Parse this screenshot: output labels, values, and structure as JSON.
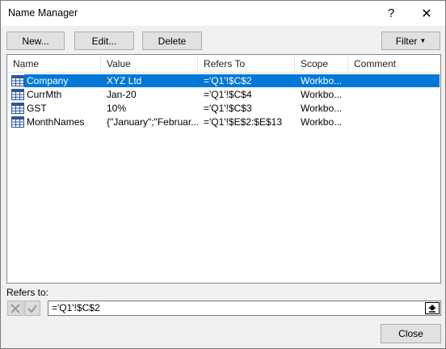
{
  "window": {
    "title": "Name Manager",
    "help_label": "?",
    "close_label": "✕"
  },
  "toolbar": {
    "new_label": "New...",
    "edit_label": "Edit...",
    "delete_label": "Delete",
    "filter_label": "Filter"
  },
  "list": {
    "columns": [
      "Name",
      "Value",
      "Refers To",
      "Scope",
      "Comment"
    ],
    "rows": [
      {
        "name": "Company",
        "value": "XYZ Ltd",
        "refers_to": "='Q1'!$C$2",
        "scope": "Workbo...",
        "comment": "",
        "selected": true
      },
      {
        "name": "CurrMth",
        "value": "Jan-20",
        "refers_to": "='Q1'!$C$4",
        "scope": "Workbo...",
        "comment": ""
      },
      {
        "name": "GST",
        "value": "10%",
        "refers_to": "='Q1'!$C$3",
        "scope": "Workbo...",
        "comment": ""
      },
      {
        "name": "MonthNames",
        "value": "{\"January\";\"Februar...",
        "refers_to": "='Q1'!$E$2:$E$13",
        "scope": "Workbo...",
        "comment": ""
      }
    ]
  },
  "refers": {
    "label": "Refers to:",
    "value": "='Q1'!$C$2"
  },
  "footer": {
    "close_label": "Close"
  },
  "colors": {
    "selection": "#0078d7",
    "dialog_bg": "#f0f0f0",
    "button_bg": "#e1e1e1"
  },
  "icons": {
    "row_icon": "table-name-icon",
    "cancel": "cancel-x-icon",
    "confirm": "checkmark-icon",
    "collapse": "collapse-dialog-icon"
  }
}
